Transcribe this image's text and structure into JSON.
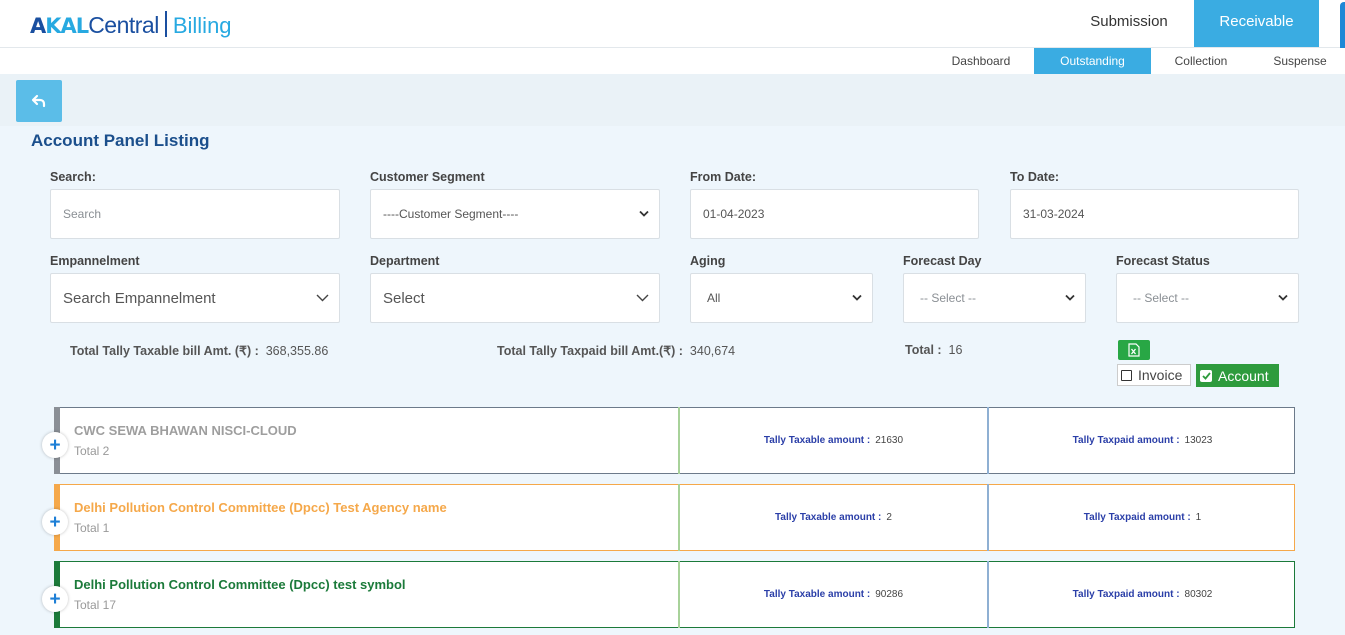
{
  "header": {
    "logo": {
      "akal_a": "A",
      "akal_ka": "KAL",
      "central": "Central",
      "billing": "Billing"
    },
    "tabs": [
      {
        "label": "Submission",
        "active": false
      },
      {
        "label": "Receivable",
        "active": true
      }
    ],
    "accent_color": "#3aace2"
  },
  "subnav": {
    "tabs": [
      {
        "label": "Dashboard",
        "active": false
      },
      {
        "label": "Outstanding",
        "active": true
      },
      {
        "label": "Collection",
        "active": false
      },
      {
        "label": "Suspense",
        "active": false
      }
    ]
  },
  "page_title": "Account Panel Listing",
  "filters": {
    "search": {
      "label": "Search:",
      "placeholder": "Search",
      "value": ""
    },
    "customer_segment": {
      "label": "Customer Segment",
      "value": "----Customer Segment----"
    },
    "from_date": {
      "label": "From Date:",
      "value": "01-04-2023"
    },
    "to_date": {
      "label": "To Date:",
      "value": "31-03-2024"
    },
    "empannelment": {
      "label": "Empannelment",
      "placeholder": "Search Empannelment"
    },
    "department": {
      "label": "Department",
      "value": "Select"
    },
    "aging": {
      "label": "Aging",
      "value": "All"
    },
    "forecast_day": {
      "label": "Forecast Day",
      "value": "-- Select --"
    },
    "forecast_status": {
      "label": "Forecast Status",
      "value": "-- Select --"
    }
  },
  "totals": {
    "taxable_label": "Total Tally Taxable bill Amt. (₹) :",
    "taxable_value": "368,355.86",
    "taxpaid_label": "Total Tally Taxpaid bill Amt.(₹) :",
    "taxpaid_value": "340,674",
    "total_label": "Total :",
    "total_value": "16"
  },
  "actions": {
    "invoice_label": "Invoice",
    "invoice_checked": false,
    "account_label": "Account",
    "account_checked": true
  },
  "accounts": [
    {
      "name": "CWC SEWA BHAWAN NISCI-CLOUD",
      "count": "Total 2",
      "taxable_label": "Tally Taxable amount :",
      "taxable": "21630",
      "taxpaid_label": "Tally Taxpaid amount :",
      "taxpaid": "13023",
      "color": "#9e9e9e"
    },
    {
      "name": "Delhi Pollution Control Committee (Dpcc) Test Agency name",
      "count": "Total 1",
      "taxable_label": "Tally Taxable amount :",
      "taxable": "2",
      "taxpaid_label": "Tally Taxpaid amount :",
      "taxpaid": "1",
      "color": "#f5a84a"
    },
    {
      "name": "Delhi Pollution Control Committee (Dpcc) test symbol",
      "count": "Total 17",
      "taxable_label": "Tally Taxable amount :",
      "taxable": "90286",
      "taxpaid_label": "Tally Taxpaid amount :",
      "taxpaid": "80302",
      "color": "#1b7a3a"
    }
  ]
}
